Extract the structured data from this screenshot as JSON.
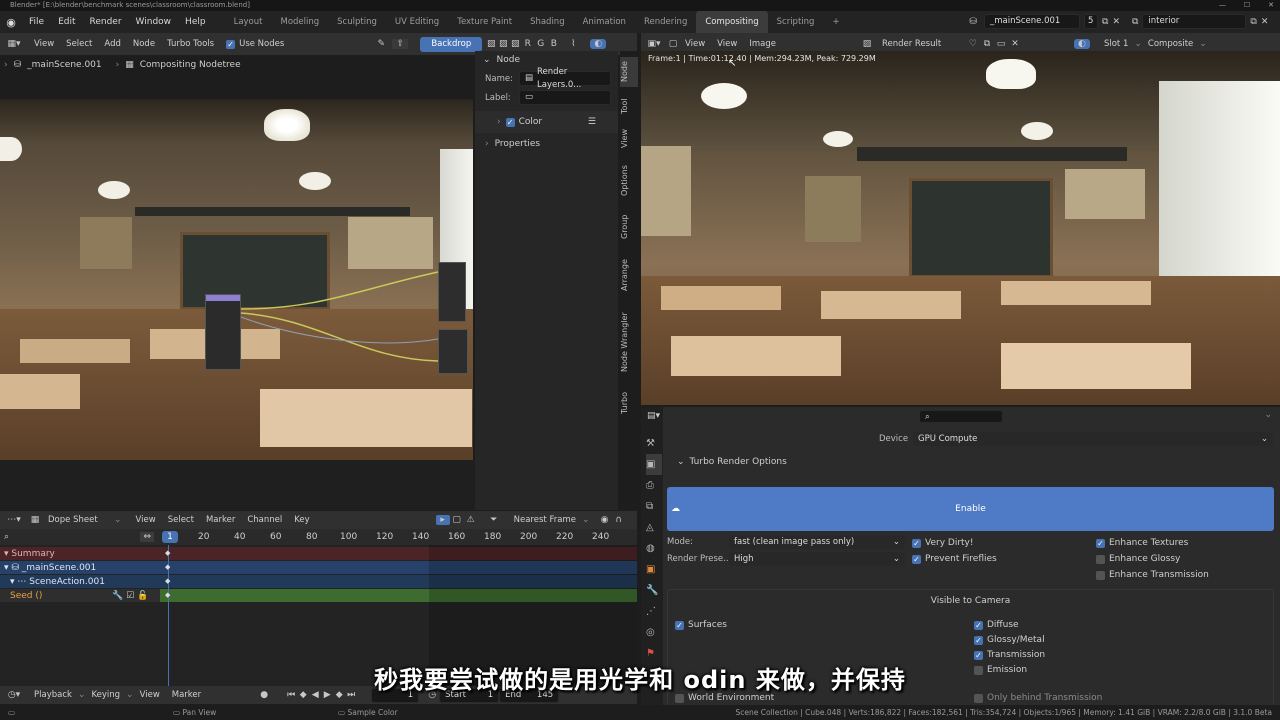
{
  "window": {
    "title": "Blender* [E:\\blender\\benchmark scenes\\classroom\\classroom.blend]",
    "controls": [
      "—",
      "☐",
      "✕"
    ]
  },
  "top_menu": [
    "File",
    "Edit",
    "Render",
    "Window",
    "Help"
  ],
  "workspaces": [
    "Layout",
    "Modeling",
    "Sculpting",
    "UV Editing",
    "Texture Paint",
    "Shading",
    "Animation",
    "Rendering",
    "Compositing",
    "Scripting"
  ],
  "active_workspace": "Compositing",
  "scene": {
    "name": "_mainScene.001",
    "users": "5",
    "view_layer": "interior"
  },
  "node_editor": {
    "menu": [
      "View",
      "Select",
      "Add",
      "Node",
      "Turbo Tools"
    ],
    "use_nodes": "Use Nodes",
    "backdrop": "Backdrop",
    "channels": [
      "R",
      "G",
      "B"
    ],
    "breadcrumb_scene": "_mainScene.001",
    "breadcrumb_tree": "Compositing Nodetree"
  },
  "node_panel": {
    "section": "Node",
    "name_label": "Name:",
    "name_value": "Render Layers.0...",
    "label_label": "Label:",
    "color": "Color",
    "properties": "Properties",
    "tabs": [
      "Node",
      "Tool",
      "View",
      "Options",
      "Group",
      "Arrange",
      "Node Wrangler",
      "Turbo"
    ]
  },
  "image_editor": {
    "menu": [
      "View",
      "View",
      "Image"
    ],
    "image_name": "Render Result",
    "slot": "Slot 1",
    "pass": "Composite",
    "stats": "Frame:1 | Time:01:12.40 | Mem:294.23M, Peak: 729.29M"
  },
  "render_props": {
    "device_label": "Device",
    "device": "GPU Compute",
    "turbo_header": "Turbo Render Options",
    "enable": "Enable",
    "mode_label": "Mode:",
    "mode": "fast (clean image pass only)",
    "preset_label": "Render Prese...",
    "preset": "High",
    "very_dirty": "Very Dirty!",
    "prevent_fireflies": "Prevent Fireflies",
    "enhance_textures": "Enhance Textures",
    "enhance_glossy": "Enhance Glossy",
    "enhance_transmission": "Enhance Transmission",
    "visible_header": "Visible to Camera",
    "surfaces": "Surfaces",
    "diffuse": "Diffuse",
    "glossy": "Glossy/Metal",
    "transmission": "Transmission",
    "emission": "Emission",
    "world_env": "World Environment",
    "only_behind": "Only behind Transmission"
  },
  "dopesheet": {
    "mode": "Dope Sheet",
    "menu": [
      "View",
      "Select",
      "Marker",
      "Channel",
      "Key"
    ],
    "snap": "Nearest Frame",
    "current_frame": "1",
    "ticks": [
      "20",
      "40",
      "60",
      "80",
      "100",
      "120",
      "140",
      "160",
      "180",
      "200",
      "220",
      "240"
    ],
    "channels": [
      "Summary",
      "_mainScene.001",
      "SceneAction.001",
      "Seed ()"
    ]
  },
  "timeline": {
    "menu": [
      "Playback",
      "Keying",
      "View",
      "Marker"
    ],
    "start_label": "Start",
    "start": "1",
    "end_label": "End",
    "end": "145"
  },
  "statusbar": {
    "pan": "Pan View",
    "sample": "Sample Color",
    "info": "Scene Collection | Cube.048 | Verts:186,822 | Faces:182,561 | Tris:354,724 | Objects:1/965 | Memory: 1.41 GiB | VRAM: 2.2/8.0 GiB | 3.1.0 Beta"
  },
  "subtitle": "秒我要尝试做的是用光学和 odin 来做，并保持",
  "colors": {
    "accent": "#4772b3",
    "summary_row": "#5a2a2e",
    "scene_row": "#2b4a73",
    "seed_row": "#3f6b2f"
  }
}
